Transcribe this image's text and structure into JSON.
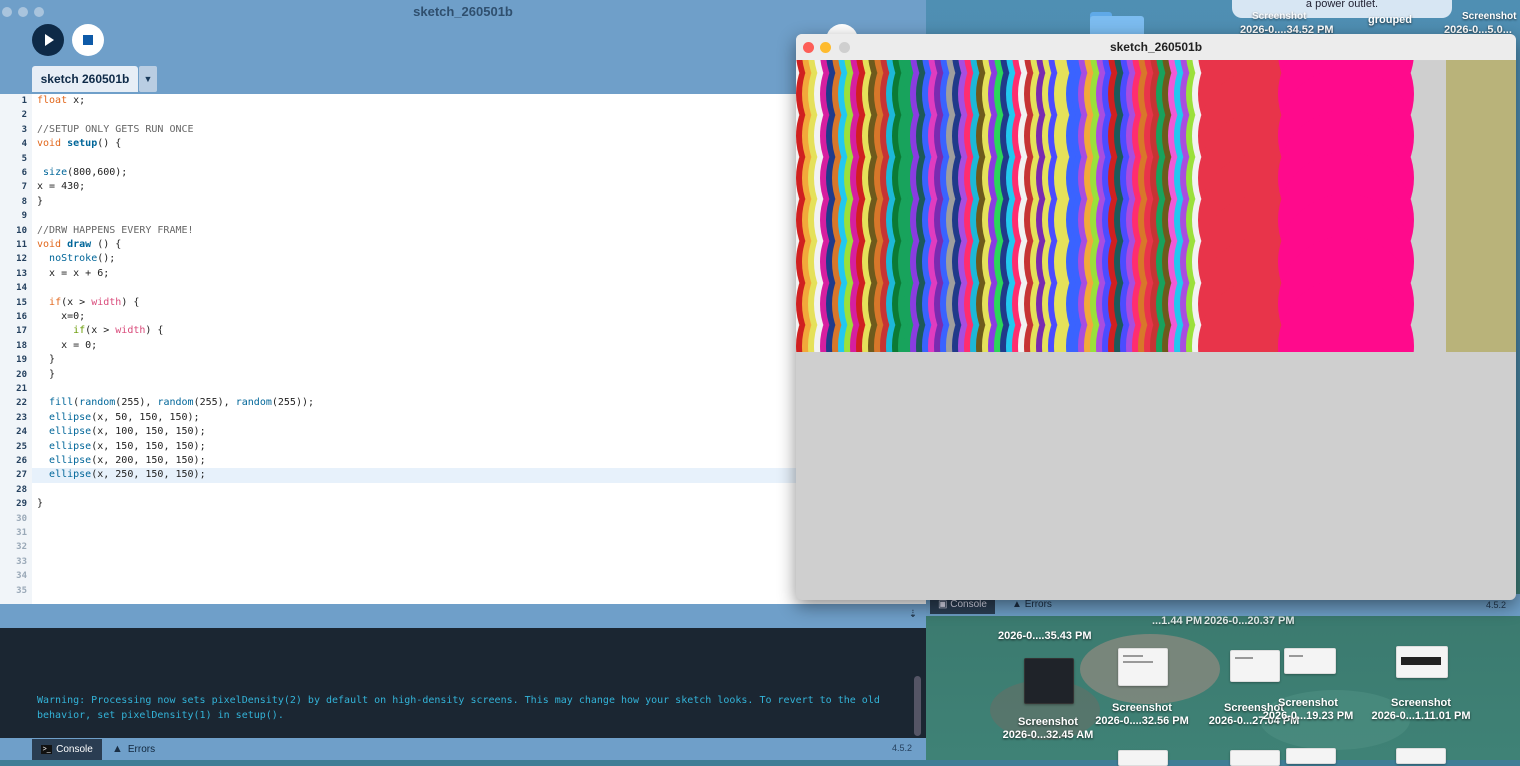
{
  "desktop": {
    "notification": "a power outlet.",
    "top_labels": [
      "Screenshot",
      "2026-0....34.52 PM",
      "grouped",
      "Screenshot",
      "2026-0...5.0..."
    ],
    "side_console_tab": "Console",
    "side_errors_tab": "Errors",
    "side_version": "4.5.2",
    "row1_labels": [
      "2026-0....35.43 PM",
      "...1.44 PM",
      "2026-0...20.37 PM"
    ],
    "icons": [
      {
        "name": "Screenshot",
        "date": "2026-0...32.45 AM"
      },
      {
        "name": "Screenshot",
        "date": "2026-0....32.56 PM"
      },
      {
        "name": "Screenshot",
        "date": "2026-0...27.04 PM"
      },
      {
        "name": "Screenshot",
        "date": "2026-0...19.23 PM"
      },
      {
        "name": "Screenshot",
        "date": "2026-0...1.11.01 PM"
      }
    ]
  },
  "ide": {
    "window_title": "sketch_260501b",
    "run_icon": "play-icon",
    "stop_icon": "stop-icon",
    "tab_label": "sketch 260501b",
    "tab_menu_icon": "triangle-down-icon",
    "current_line": 27,
    "line_numbers": [
      "1",
      "2",
      "3",
      "4",
      "5",
      "6",
      "7",
      "8",
      "9",
      "10",
      "11",
      "12",
      "13",
      "14",
      "15",
      "16",
      "17",
      "18",
      "19",
      "20",
      "21",
      "22",
      "23",
      "24",
      "25",
      "26",
      "27",
      "28",
      "29",
      "30",
      "31",
      "32",
      "33",
      "34",
      "35"
    ],
    "code": [
      "float x;",
      "",
      "//SETUP ONLY GETS RUN ONCE",
      "void setup() {",
      "",
      " size(800,600);",
      "x = 430;",
      "}",
      "",
      "//DRW HAPPENS EVERY FRAME!",
      "void draw () {",
      "  noStroke();",
      "  x = x + 6;",
      "",
      "  if(x > width) {",
      "    x=0;",
      "      if(x > width) {",
      "    x = 0;",
      "  }",
      "  }",
      "",
      "  fill(random(255), random(255), random(255));",
      "  ellipse(x, 50, 150, 150);",
      "  ellipse(x, 100, 150, 150);",
      "  ellipse(x, 150, 150, 150);",
      "  ellipse(x, 200, 150, 150);",
      "  ellipse(x, 250, 150, 150);",
      "",
      "}",
      "",
      "",
      "",
      "",
      "",
      ""
    ],
    "console_text": "Warning: Processing now sets pixelDensity(2) by default on high-density screens. This may change how your sketch looks. To revert to the old behavior, set pixelDensity(1) in setup().",
    "console_tab": "Console",
    "errors_tab": "Errors",
    "version": "4.5.2",
    "colors": {
      "accent": "#0e2a47",
      "bar": "#6f9fc9",
      "console_bg": "#1b2632",
      "console_text": "#33b3d8"
    }
  },
  "sketch_window": {
    "title": "sketch_260501b",
    "background": "#cfcfcf",
    "current_ellipse_color": "#ff0a8c"
  }
}
